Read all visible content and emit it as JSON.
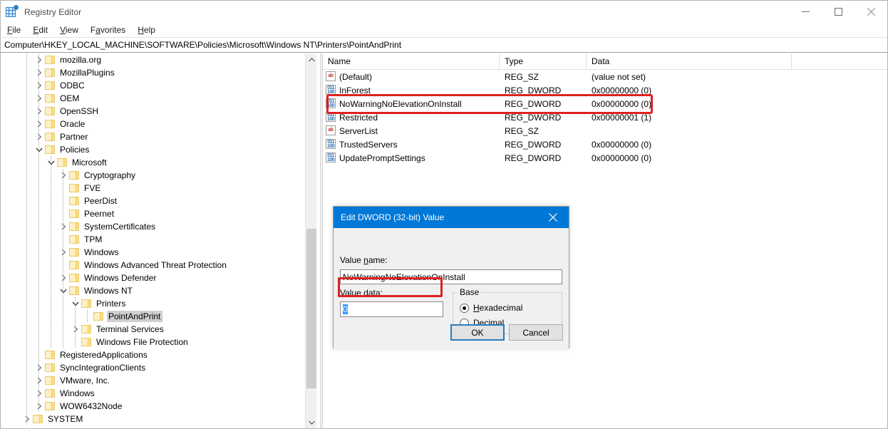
{
  "window": {
    "title": "Registry Editor",
    "icon": "registry-editor-icon",
    "controls": {
      "minimize": "minimize-icon",
      "maximize": "maximize-icon",
      "close": "close-icon"
    }
  },
  "menubar": {
    "items": [
      {
        "label": "File",
        "accel": "F"
      },
      {
        "label": "Edit",
        "accel": "E"
      },
      {
        "label": "View",
        "accel": "V"
      },
      {
        "label": "Favorites",
        "accel": "a"
      },
      {
        "label": "Help",
        "accel": "H"
      }
    ]
  },
  "address": {
    "path": "Computer\\HKEY_LOCAL_MACHINE\\SOFTWARE\\Policies\\Microsoft\\Windows NT\\Printers\\PointAndPrint"
  },
  "tree": {
    "items": [
      {
        "label": "mozilla.org",
        "depth": 1,
        "toggle": "collapsed",
        "selected": false
      },
      {
        "label": "MozillaPlugins",
        "depth": 1,
        "toggle": "collapsed",
        "selected": false
      },
      {
        "label": "ODBC",
        "depth": 1,
        "toggle": "collapsed",
        "selected": false
      },
      {
        "label": "OEM",
        "depth": 1,
        "toggle": "collapsed",
        "selected": false
      },
      {
        "label": "OpenSSH",
        "depth": 1,
        "toggle": "collapsed",
        "selected": false
      },
      {
        "label": "Oracle",
        "depth": 1,
        "toggle": "collapsed",
        "selected": false
      },
      {
        "label": "Partner",
        "depth": 1,
        "toggle": "collapsed",
        "selected": false
      },
      {
        "label": "Policies",
        "depth": 1,
        "toggle": "expanded",
        "selected": false
      },
      {
        "label": "Microsoft",
        "depth": 2,
        "toggle": "expanded",
        "selected": false
      },
      {
        "label": "Cryptography",
        "depth": 3,
        "toggle": "collapsed",
        "selected": false
      },
      {
        "label": "FVE",
        "depth": 3,
        "toggle": "none",
        "selected": false
      },
      {
        "label": "PeerDist",
        "depth": 3,
        "toggle": "none",
        "selected": false
      },
      {
        "label": "Peernet",
        "depth": 3,
        "toggle": "none",
        "selected": false
      },
      {
        "label": "SystemCertificates",
        "depth": 3,
        "toggle": "collapsed",
        "selected": false
      },
      {
        "label": "TPM",
        "depth": 3,
        "toggle": "none",
        "selected": false
      },
      {
        "label": "Windows",
        "depth": 3,
        "toggle": "collapsed",
        "selected": false
      },
      {
        "label": "Windows Advanced Threat Protection",
        "depth": 3,
        "toggle": "none",
        "selected": false
      },
      {
        "label": "Windows Defender",
        "depth": 3,
        "toggle": "collapsed",
        "selected": false
      },
      {
        "label": "Windows NT",
        "depth": 3,
        "toggle": "expanded",
        "selected": false
      },
      {
        "label": "Printers",
        "depth": 4,
        "toggle": "expanded",
        "selected": false
      },
      {
        "label": "PointAndPrint",
        "depth": 5,
        "toggle": "none",
        "selected": true
      },
      {
        "label": "Terminal Services",
        "depth": 4,
        "toggle": "collapsed",
        "selected": false
      },
      {
        "label": "Windows File Protection",
        "depth": 4,
        "toggle": "none",
        "selected": false
      },
      {
        "label": "RegisteredApplications",
        "depth": 1,
        "toggle": "none",
        "selected": false
      },
      {
        "label": "SyncIntegrationClients",
        "depth": 1,
        "toggle": "collapsed",
        "selected": false
      },
      {
        "label": "VMware, Inc.",
        "depth": 1,
        "toggle": "collapsed",
        "selected": false
      },
      {
        "label": "Windows",
        "depth": 1,
        "toggle": "collapsed",
        "selected": false
      },
      {
        "label": "WOW6432Node",
        "depth": 1,
        "toggle": "collapsed",
        "selected": false
      },
      {
        "label": "SYSTEM",
        "depth": 0,
        "toggle": "collapsed",
        "selected": false
      }
    ]
  },
  "values": {
    "columns": [
      "Name",
      "Type",
      "Data"
    ],
    "rows": [
      {
        "name": "(Default)",
        "type": "REG_SZ",
        "data": "(value not set)",
        "icon": "string-value-icon"
      },
      {
        "name": "InForest",
        "type": "REG_DWORD",
        "data": "0x00000000 (0)",
        "icon": "dword-value-icon"
      },
      {
        "name": "NoWarningNoElevationOnInstall",
        "type": "REG_DWORD",
        "data": "0x00000000 (0)",
        "icon": "dword-value-icon"
      },
      {
        "name": "Restricted",
        "type": "REG_DWORD",
        "data": "0x00000001 (1)",
        "icon": "dword-value-icon"
      },
      {
        "name": "ServerList",
        "type": "REG_SZ",
        "data": "",
        "icon": "string-value-icon"
      },
      {
        "name": "TrustedServers",
        "type": "REG_DWORD",
        "data": "0x00000000 (0)",
        "icon": "dword-value-icon"
      },
      {
        "name": "UpdatePromptSettings",
        "type": "REG_DWORD",
        "data": "0x00000000 (0)",
        "icon": "dword-value-icon"
      }
    ]
  },
  "dialog": {
    "title": "Edit DWORD (32-bit) Value",
    "close_icon": "close-icon",
    "value_name_label": "Value name:",
    "value_name_accel": "n",
    "value_name": "NoWarningNoElevationOnInstall",
    "value_data_label": "Value data:",
    "value_data_accel": "V",
    "value_data": "0",
    "base_legend": "Base",
    "base_options": [
      {
        "label": "Hexadecimal",
        "accel": "H",
        "selected": true
      },
      {
        "label": "Decimal",
        "accel": "D",
        "selected": false
      }
    ],
    "ok_label": "OK",
    "cancel_label": "Cancel"
  },
  "annotations": {
    "color": "#e02020",
    "highlight_row": "NoWarningNoElevationOnInstall",
    "highlight_field": "value-data-field"
  }
}
